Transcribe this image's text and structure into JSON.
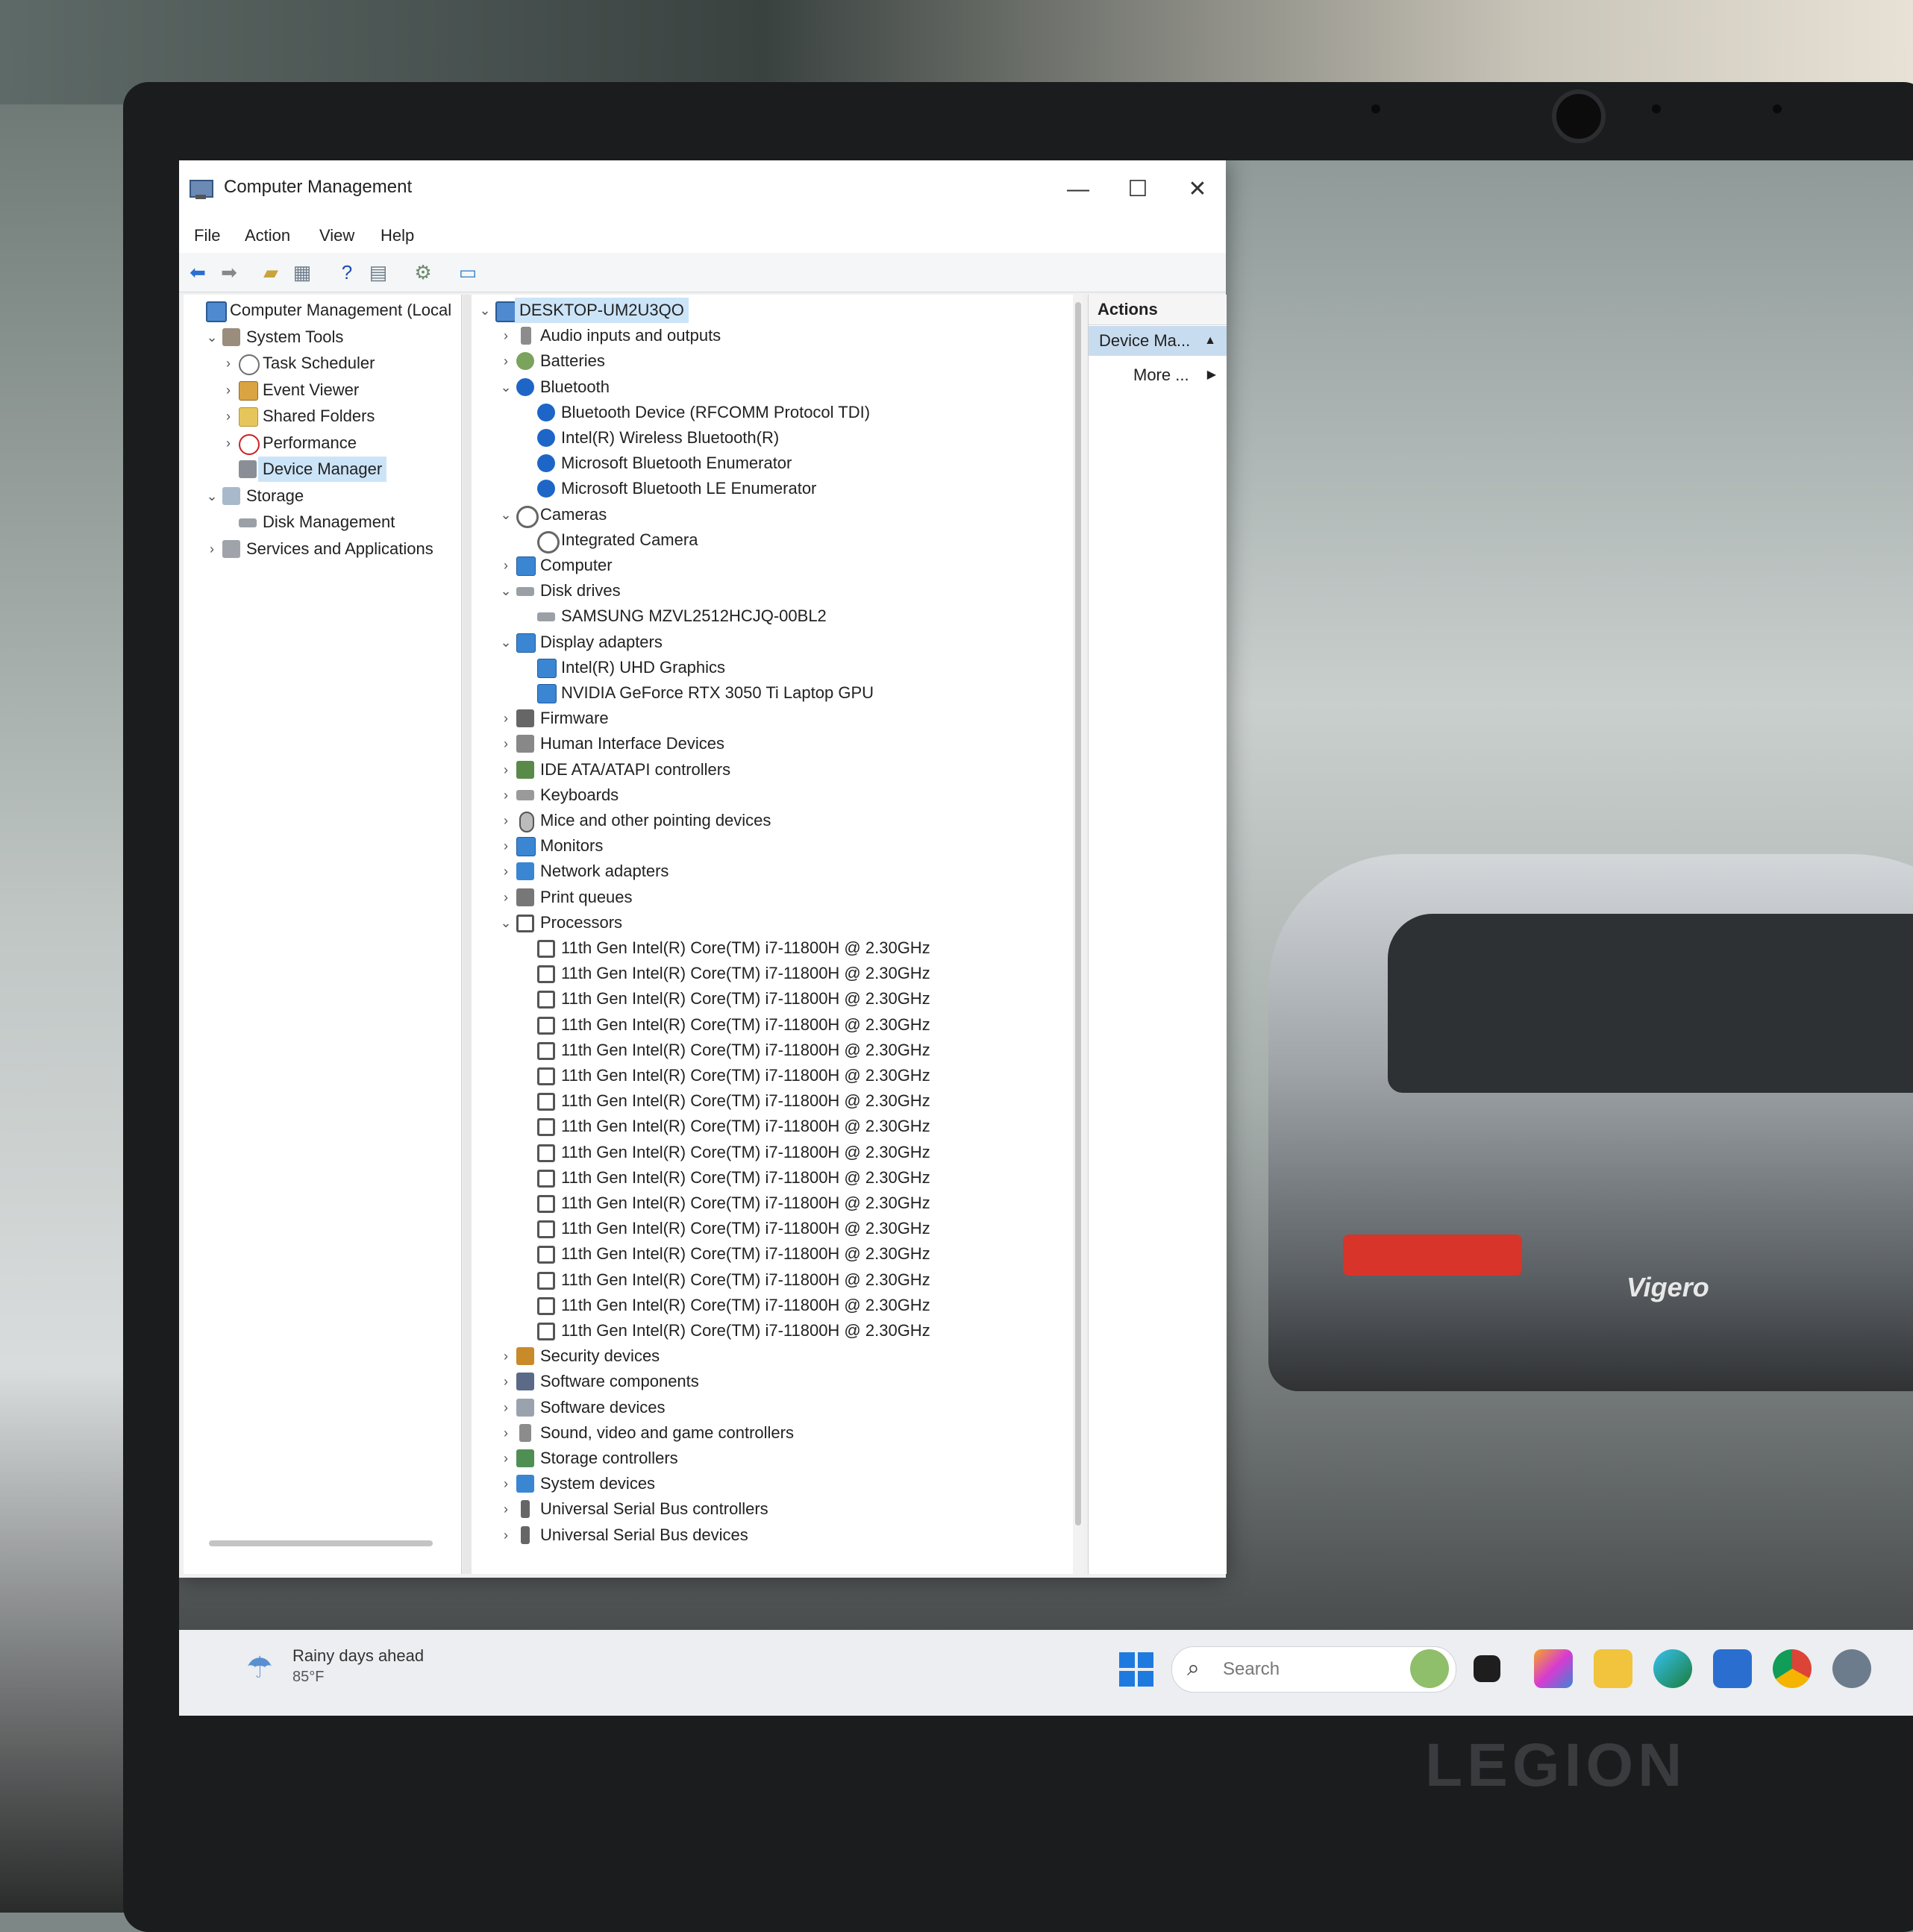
{
  "window": {
    "title": "Computer Management",
    "minimize_glyph": "—",
    "maximize_glyph": "☐",
    "close_glyph": "✕"
  },
  "menu": [
    "File",
    "Action",
    "View",
    "Help"
  ],
  "toolbar_icons": [
    "back-arrow-icon",
    "forward-arrow-icon",
    "up-folder-icon",
    "show-hide-tree-icon",
    "help-icon",
    "properties-icon",
    "scan-hardware-icon",
    "monitor-icon"
  ],
  "left_tree": [
    {
      "label": "Computer Management (Local",
      "chevron": "",
      "icon": "pc",
      "indent": 0
    },
    {
      "label": "System Tools",
      "chevron": "⌄",
      "icon": "tool",
      "indent": 1
    },
    {
      "label": "Task Scheduler",
      "chevron": "›",
      "icon": "clock",
      "indent": 2
    },
    {
      "label": "Event Viewer",
      "chevron": "›",
      "icon": "log",
      "indent": 2
    },
    {
      "label": "Shared Folders",
      "chevron": "›",
      "icon": "folder",
      "indent": 2
    },
    {
      "label": "Performance",
      "chevron": "›",
      "icon": "perf",
      "indent": 2
    },
    {
      "label": "Device Manager",
      "chevron": "",
      "icon": "dev",
      "indent": 2,
      "selected": true
    },
    {
      "label": "Storage",
      "chevron": "⌄",
      "icon": "storage",
      "indent": 1
    },
    {
      "label": "Disk Management",
      "chevron": "",
      "icon": "disk",
      "indent": 2
    },
    {
      "label": "Services and Applications",
      "chevron": "›",
      "icon": "svc",
      "indent": 1
    }
  ],
  "device_tree": [
    {
      "label": "DESKTOP-UM2U3QO",
      "chevron": "⌄",
      "icon": "pc",
      "indent": 0,
      "selected": true
    },
    {
      "label": "Audio inputs and outputs",
      "chevron": "›",
      "icon": "audio",
      "indent": 1
    },
    {
      "label": "Batteries",
      "chevron": "›",
      "icon": "battery",
      "indent": 1
    },
    {
      "label": "Bluetooth",
      "chevron": "⌄",
      "icon": "bt",
      "indent": 1
    },
    {
      "label": "Bluetooth Device (RFCOMM Protocol TDI)",
      "chevron": "",
      "icon": "bt",
      "indent": 2
    },
    {
      "label": "Intel(R) Wireless Bluetooth(R)",
      "chevron": "",
      "icon": "bt",
      "indent": 2
    },
    {
      "label": "Microsoft Bluetooth Enumerator",
      "chevron": "",
      "icon": "bt",
      "indent": 2
    },
    {
      "label": "Microsoft Bluetooth LE Enumerator",
      "chevron": "",
      "icon": "bt",
      "indent": 2
    },
    {
      "label": "Cameras",
      "chevron": "⌄",
      "icon": "cam",
      "indent": 1
    },
    {
      "label": "Integrated Camera",
      "chevron": "",
      "icon": "cam",
      "indent": 2
    },
    {
      "label": "Computer",
      "chevron": "›",
      "icon": "monitor",
      "indent": 1
    },
    {
      "label": "Disk drives",
      "chevron": "⌄",
      "icon": "disk",
      "indent": 1
    },
    {
      "label": "SAMSUNG MZVL2512HCJQ-00BL2",
      "chevron": "",
      "icon": "disk",
      "indent": 2
    },
    {
      "label": "Display adapters",
      "chevron": "⌄",
      "icon": "monitor",
      "indent": 1
    },
    {
      "label": "Intel(R) UHD Graphics",
      "chevron": "",
      "icon": "monitor",
      "indent": 2
    },
    {
      "label": "NVIDIA GeForce RTX 3050 Ti Laptop GPU",
      "chevron": "",
      "icon": "monitor",
      "indent": 2
    },
    {
      "label": "Firmware",
      "chevron": "›",
      "icon": "firm",
      "indent": 1
    },
    {
      "label": "Human Interface Devices",
      "chevron": "›",
      "icon": "hid",
      "indent": 1
    },
    {
      "label": "IDE ATA/ATAPI controllers",
      "chevron": "›",
      "icon": "ide",
      "indent": 1
    },
    {
      "label": "Keyboards",
      "chevron": "›",
      "icon": "kbd",
      "indent": 1
    },
    {
      "label": "Mice and other pointing devices",
      "chevron": "›",
      "icon": "mouse",
      "indent": 1
    },
    {
      "label": "Monitors",
      "chevron": "›",
      "icon": "monitor",
      "indent": 1
    },
    {
      "label": "Network adapters",
      "chevron": "›",
      "icon": "net",
      "indent": 1
    },
    {
      "label": "Print queues",
      "chevron": "›",
      "icon": "print",
      "indent": 1
    },
    {
      "label": "Processors",
      "chevron": "⌄",
      "icon": "chip",
      "indent": 1
    },
    {
      "label": "11th Gen Intel(R) Core(TM) i7-11800H @ 2.30GHz",
      "chevron": "",
      "icon": "chip",
      "indent": 2
    },
    {
      "label": "11th Gen Intel(R) Core(TM) i7-11800H @ 2.30GHz",
      "chevron": "",
      "icon": "chip",
      "indent": 2
    },
    {
      "label": "11th Gen Intel(R) Core(TM) i7-11800H @ 2.30GHz",
      "chevron": "",
      "icon": "chip",
      "indent": 2
    },
    {
      "label": "11th Gen Intel(R) Core(TM) i7-11800H @ 2.30GHz",
      "chevron": "",
      "icon": "chip",
      "indent": 2
    },
    {
      "label": "11th Gen Intel(R) Core(TM) i7-11800H @ 2.30GHz",
      "chevron": "",
      "icon": "chip",
      "indent": 2
    },
    {
      "label": "11th Gen Intel(R) Core(TM) i7-11800H @ 2.30GHz",
      "chevron": "",
      "icon": "chip",
      "indent": 2
    },
    {
      "label": "11th Gen Intel(R) Core(TM) i7-11800H @ 2.30GHz",
      "chevron": "",
      "icon": "chip",
      "indent": 2
    },
    {
      "label": "11th Gen Intel(R) Core(TM) i7-11800H @ 2.30GHz",
      "chevron": "",
      "icon": "chip",
      "indent": 2
    },
    {
      "label": "11th Gen Intel(R) Core(TM) i7-11800H @ 2.30GHz",
      "chevron": "",
      "icon": "chip",
      "indent": 2
    },
    {
      "label": "11th Gen Intel(R) Core(TM) i7-11800H @ 2.30GHz",
      "chevron": "",
      "icon": "chip",
      "indent": 2
    },
    {
      "label": "11th Gen Intel(R) Core(TM) i7-11800H @ 2.30GHz",
      "chevron": "",
      "icon": "chip",
      "indent": 2
    },
    {
      "label": "11th Gen Intel(R) Core(TM) i7-11800H @ 2.30GHz",
      "chevron": "",
      "icon": "chip",
      "indent": 2
    },
    {
      "label": "11th Gen Intel(R) Core(TM) i7-11800H @ 2.30GHz",
      "chevron": "",
      "icon": "chip",
      "indent": 2
    },
    {
      "label": "11th Gen Intel(R) Core(TM) i7-11800H @ 2.30GHz",
      "chevron": "",
      "icon": "chip",
      "indent": 2
    },
    {
      "label": "11th Gen Intel(R) Core(TM) i7-11800H @ 2.30GHz",
      "chevron": "",
      "icon": "chip",
      "indent": 2
    },
    {
      "label": "11th Gen Intel(R) Core(TM) i7-11800H @ 2.30GHz",
      "chevron": "",
      "icon": "chip",
      "indent": 2
    },
    {
      "label": "Security devices",
      "chevron": "›",
      "icon": "sec",
      "indent": 1
    },
    {
      "label": "Software components",
      "chevron": "›",
      "icon": "comp",
      "indent": 1
    },
    {
      "label": "Software devices",
      "chevron": "›",
      "icon": "swdev",
      "indent": 1
    },
    {
      "label": "Sound, video and game controllers",
      "chevron": "›",
      "icon": "sound",
      "indent": 1
    },
    {
      "label": "Storage controllers",
      "chevron": "›",
      "icon": "stor",
      "indent": 1
    },
    {
      "label": "System devices",
      "chevron": "›",
      "icon": "sys",
      "indent": 1
    },
    {
      "label": "Universal Serial Bus controllers",
      "chevron": "›",
      "icon": "usb",
      "indent": 1
    },
    {
      "label": "Universal Serial Bus devices",
      "chevron": "›",
      "icon": "usb",
      "indent": 1
    }
  ],
  "actions": {
    "header": "Actions",
    "section": "Device Ma...",
    "section_arrow": "▲",
    "more": "More ...",
    "more_arrow": "▶"
  },
  "taskbar": {
    "weather_title": "Rainy days ahead",
    "weather_temp": "85°F",
    "search_placeholder": "Search",
    "search_glyph": "⌕",
    "weather_glyph": "☂",
    "icons": [
      "start-icon",
      "widgets-icon",
      "task-view-icon",
      "copilot-icon",
      "file-explorer-icon",
      "edge-icon",
      "store-icon",
      "chrome-icon",
      "settings-icon"
    ]
  },
  "laptop": {
    "brand": "LEGION",
    "car_badge": "Vigero"
  },
  "colors": {
    "selection": "#cce4f7",
    "accent": "#1f7ae0",
    "bluetooth": "#1d66c8"
  }
}
